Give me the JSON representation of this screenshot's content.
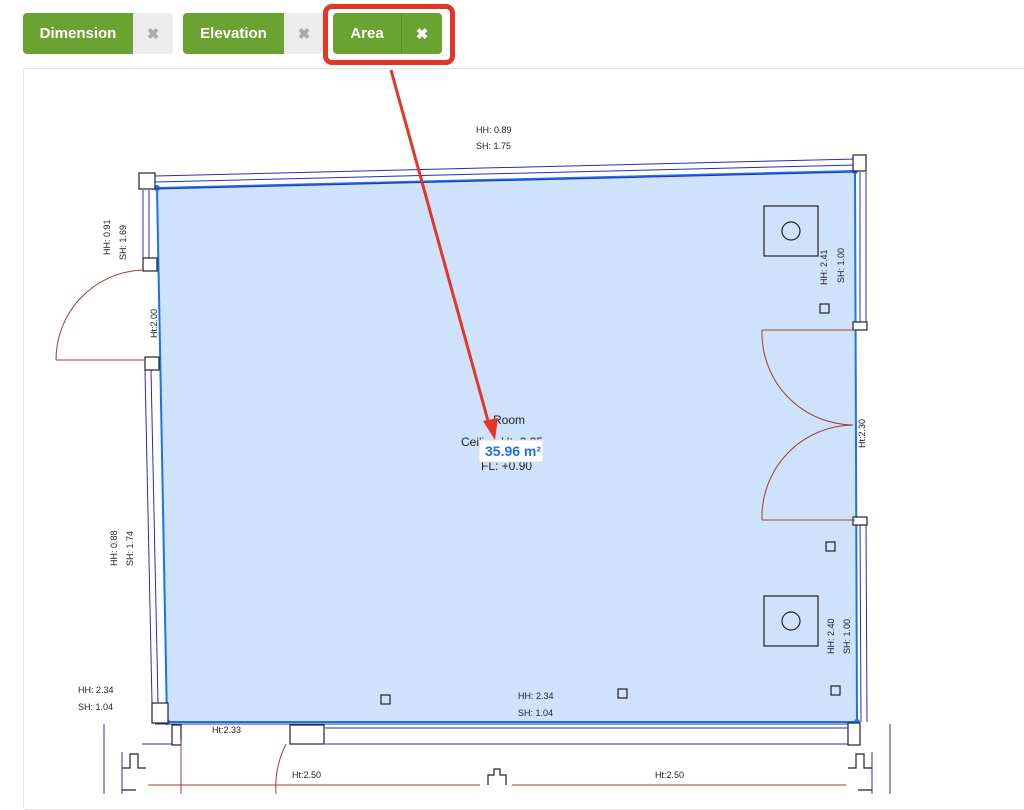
{
  "toolbar": {
    "dimension_label": "Dimension",
    "elevation_label": "Elevation",
    "area_label": "Area",
    "close_glyph": "✖"
  },
  "plan": {
    "room_name": "Room",
    "ceiling_label": "Ceiling Ht: 2.35",
    "floor_level_label": "FL: +0.90",
    "area_value": "35.96 m²",
    "top_window_hh": "HH: 0.89",
    "top_window_sh": "SH: 1.75",
    "left_window_hh": "HH: 0.91",
    "left_window_sh": "SH: 1.69",
    "left_door_ht": "Ht:2.00",
    "left_lower_window_hh": "HH: 0.88",
    "left_lower_window_sh": "SH: 1.74",
    "right_upper_window_hh": "HH: 2.41",
    "right_upper_window_sh": "SH: 1.00",
    "right_door_ht": "Ht:2.30",
    "right_lower_window_hh": "HH: 2.40",
    "right_lower_window_sh": "SH: 1.00",
    "bottom_left_hh": "HH: 2.34",
    "bottom_left_sh": "SH: 1.04",
    "bottom_window_hh": "HH: 2.34",
    "bottom_window_sh": "SH: 1.04",
    "bottom_door_ht": "Ht:2.33",
    "lower_ht_left": "Ht:2.50",
    "lower_ht_right": "Ht:2.50"
  },
  "colors": {
    "accent_green": "#6aa331",
    "highlight_red": "#e2362a",
    "room_fill": "#cfe2fc",
    "room_outline": "#1a73e8",
    "wall_line": "#2a2ab5",
    "door_swing": "#a33d2a"
  }
}
